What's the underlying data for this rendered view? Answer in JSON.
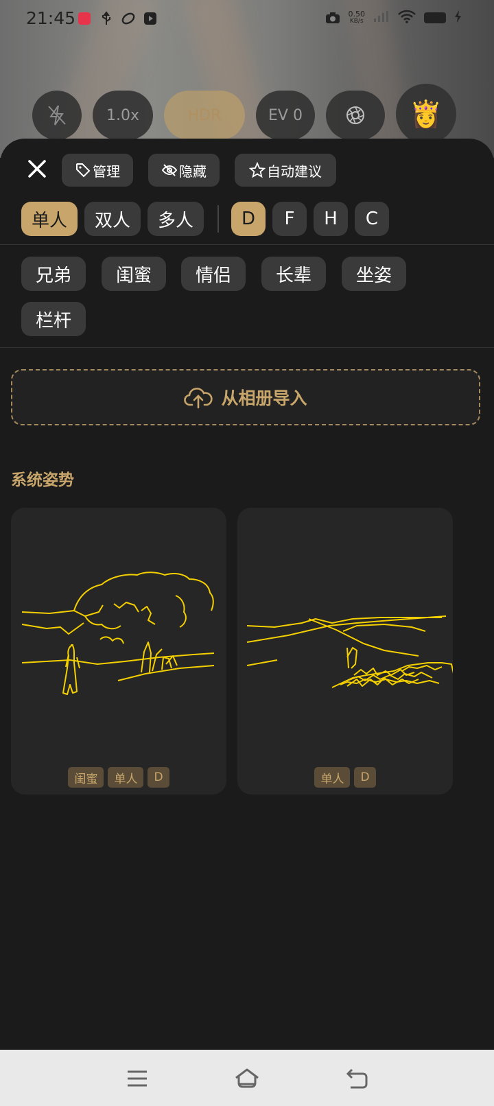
{
  "status_bar": {
    "time": "21:45",
    "net_speed_value": "0.50",
    "net_speed_unit": "KB/s",
    "icons": [
      "app-notification-icon",
      "usb-icon",
      "sync-icon",
      "video-icon",
      "camera-icon",
      "wifi-icon",
      "battery-icon",
      "charging-icon"
    ]
  },
  "camera_controls": {
    "flash": "flash-off-icon",
    "zoom": "1.0x",
    "hdr": "HDR",
    "ev": "EV 0",
    "aperture": "aperture-icon",
    "pose_avatar": "👸"
  },
  "toolbar": {
    "manage": "管理",
    "hide": "隐藏",
    "auto_suggest": "自动建议"
  },
  "people_filters": [
    {
      "label": "单人",
      "active": true
    },
    {
      "label": "双人",
      "active": false
    },
    {
      "label": "多人",
      "active": false
    }
  ],
  "letter_filters": [
    {
      "label": "D",
      "active": true
    },
    {
      "label": "F",
      "active": false
    },
    {
      "label": "H",
      "active": false
    },
    {
      "label": "C",
      "active": false
    }
  ],
  "tags": [
    "兄弟",
    "闺蜜",
    "情侣",
    "长辈",
    "坐姿",
    "栏杆"
  ],
  "import": {
    "label": "从相册导入"
  },
  "section": {
    "title": "系统姿势"
  },
  "cards": [
    {
      "badges": [
        "闺蜜",
        "单人",
        "D"
      ]
    },
    {
      "badges": [
        "单人",
        "D"
      ]
    }
  ],
  "colors": {
    "accent": "#c8a66b",
    "sketch": "#f5d000",
    "sheet_bg": "#1b1b1b",
    "chip_bg": "#3a3a3a"
  }
}
